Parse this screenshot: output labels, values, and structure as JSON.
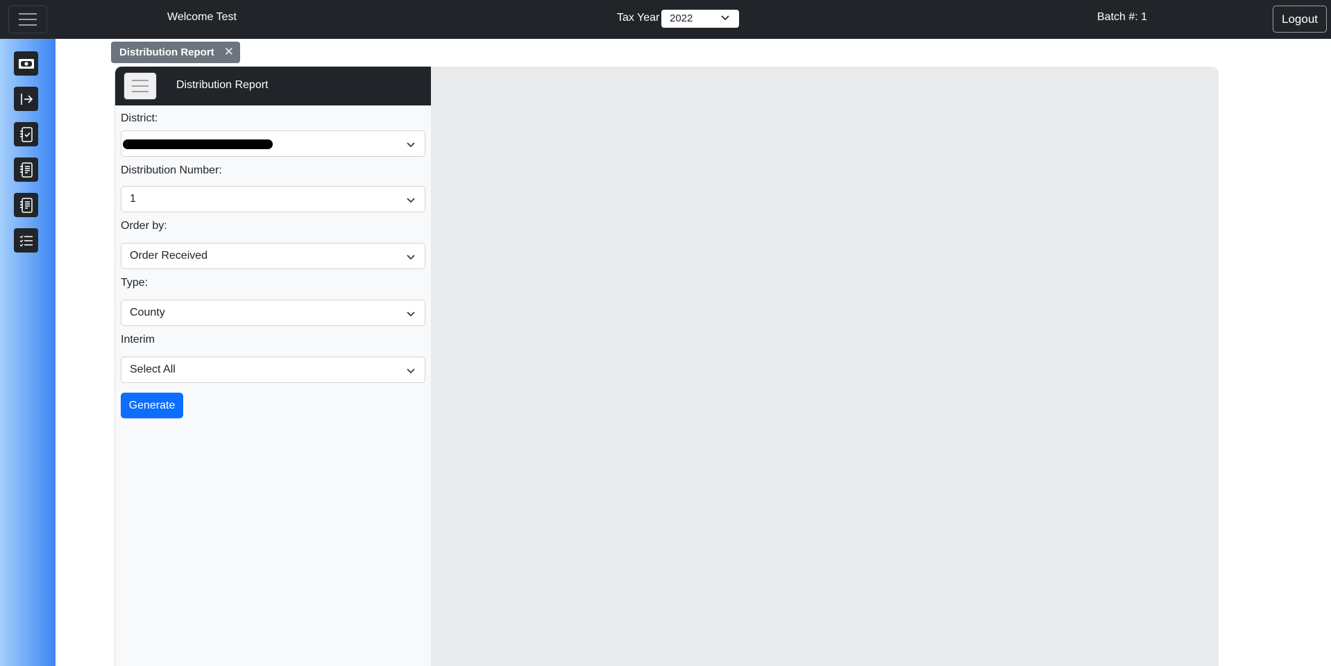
{
  "topbar": {
    "welcome": "Welcome Test",
    "tax_year_label": "Tax Year",
    "tax_year_value": "2022",
    "batch": "Batch #: 1",
    "logout": "Logout"
  },
  "sidebar": {
    "items": [
      {
        "icon": "cash-icon"
      },
      {
        "icon": "box-arrow-right-icon"
      },
      {
        "icon": "journal-check-icon"
      },
      {
        "icon": "journal-text-icon"
      },
      {
        "icon": "journal-text-icon"
      },
      {
        "icon": "list-check-icon"
      }
    ]
  },
  "tab": {
    "label": "Distribution Report",
    "close": "✕"
  },
  "panel": {
    "title": "Distribution Report",
    "fields": {
      "district": {
        "label": "District:",
        "value": "[redacted]"
      },
      "distribution_number": {
        "label": "Distribution Number:",
        "value": "1"
      },
      "order_by": {
        "label": "Order by:",
        "value": "Order Received"
      },
      "type": {
        "label": "Type:",
        "value": "County"
      },
      "interim": {
        "label": "Interim",
        "value": "Select All"
      }
    },
    "generate": "Generate"
  },
  "colors": {
    "navbar": "#212529",
    "primary": "#0d6efd",
    "tab": "#6c757d",
    "content_bg": "#e9eaec"
  }
}
